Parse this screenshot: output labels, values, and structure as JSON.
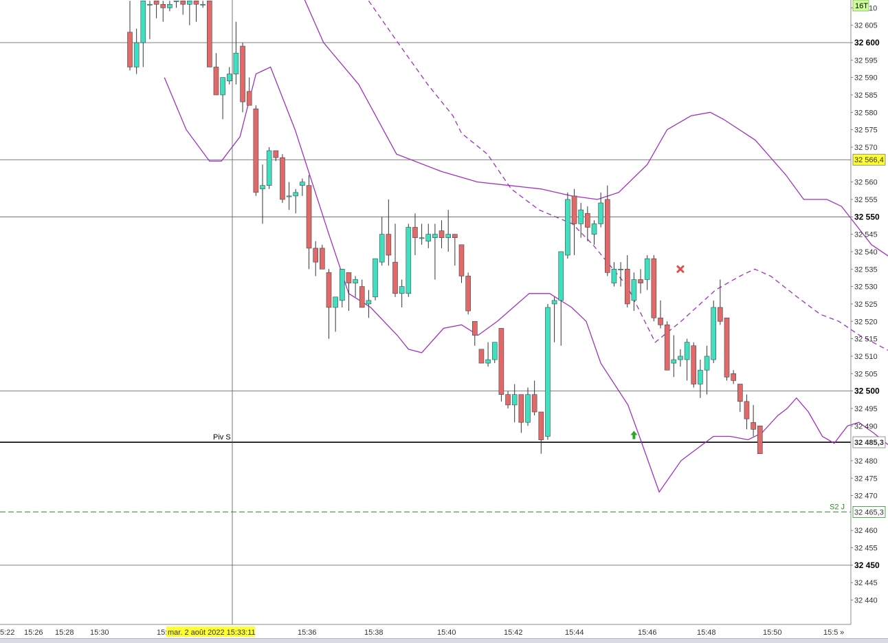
{
  "toolbar": {
    "timeframe_badge": "16T",
    "crosshair_time_label": "mar. 2 août 2022 15:33:11",
    "scroll_right_glyph": "»"
  },
  "colors": {
    "bull": "#3fe0c0",
    "bear": "#e06a6a",
    "wick": "#333333",
    "band": "#a030c0",
    "pivot_line": "#000000",
    "s2_line": "#2a8a2a",
    "grid": "#555555",
    "badge_yellow": "#ffff33",
    "badge_green": "#ccff99",
    "signal_buy": "#22aa22",
    "signal_sell": "#e05050"
  },
  "chart_data": {
    "type": "candlestick",
    "title": "",
    "xlabel": "",
    "ylabel": "",
    "ylim": [
      32433,
      32612
    ],
    "x_ticks": [
      "5:22",
      "15:26",
      "15:28",
      "15:30",
      "15:",
      "15:36",
      "15:38",
      "15:40",
      "15:42",
      "15:44",
      "15:46",
      "15:48",
      "15:50",
      "15:5"
    ],
    "y_ticks": [
      {
        "label": "10",
        "value": 32610,
        "bold": false
      },
      {
        "label": "32 605",
        "value": 32605,
        "bold": false
      },
      {
        "label": "32 600",
        "value": 32600,
        "bold": true
      },
      {
        "label": "32 595",
        "value": 32595,
        "bold": false
      },
      {
        "label": "32 590",
        "value": 32590,
        "bold": false
      },
      {
        "label": "32 585",
        "value": 32585,
        "bold": false
      },
      {
        "label": "32 580",
        "value": 32580,
        "bold": false
      },
      {
        "label": "32 575",
        "value": 32575,
        "bold": false
      },
      {
        "label": "32 570",
        "value": 32570,
        "bold": false
      },
      {
        "label": "32 560",
        "value": 32560,
        "bold": false
      },
      {
        "label": "32 555",
        "value": 32555,
        "bold": false
      },
      {
        "label": "32 550",
        "value": 32550,
        "bold": true
      },
      {
        "label": "32 545",
        "value": 32545,
        "bold": false
      },
      {
        "label": "32 540",
        "value": 32540,
        "bold": false
      },
      {
        "label": "32 535",
        "value": 32535,
        "bold": false
      },
      {
        "label": "32 530",
        "value": 32530,
        "bold": false
      },
      {
        "label": "32 525",
        "value": 32525,
        "bold": false
      },
      {
        "label": "32 520",
        "value": 32520,
        "bold": false
      },
      {
        "label": "32 515",
        "value": 32515,
        "bold": false
      },
      {
        "label": "32 510",
        "value": 32510,
        "bold": false
      },
      {
        "label": "32 505",
        "value": 32505,
        "bold": false
      },
      {
        "label": "32 500",
        "value": 32500,
        "bold": true
      },
      {
        "label": "32 495",
        "value": 32495,
        "bold": false
      },
      {
        "label": "32 490",
        "value": 32490,
        "bold": false
      },
      {
        "label": "32 480",
        "value": 32480,
        "bold": false
      },
      {
        "label": "32 475",
        "value": 32475,
        "bold": false
      },
      {
        "label": "32 470",
        "value": 32470,
        "bold": false
      },
      {
        "label": "32 460",
        "value": 32460,
        "bold": false
      },
      {
        "label": "32 455",
        "value": 32455,
        "bold": false
      },
      {
        "label": "32 450",
        "value": 32450,
        "bold": true
      },
      {
        "label": "32 445",
        "value": 32445,
        "bold": false
      },
      {
        "label": "32 440",
        "value": 32440,
        "bold": false
      }
    ],
    "h_lines": [
      {
        "value": 32600,
        "style": "grid"
      },
      {
        "value": 32566.4,
        "style": "grid",
        "badge": "32 566,4",
        "badge_color": "yellow"
      },
      {
        "value": 32550,
        "style": "grid"
      },
      {
        "value": 32500,
        "style": "grid"
      },
      {
        "value": 32485.3,
        "style": "pivot",
        "label": "Piv S",
        "badge": "32 485,3",
        "badge_color": "white"
      },
      {
        "value": 32465.3,
        "style": "s2",
        "label": "S2 J",
        "badge": "32 465,3",
        "badge_color": "white"
      },
      {
        "value": 32450,
        "style": "grid"
      }
    ],
    "candles": [
      {
        "o": 32603,
        "h": 32612,
        "l": 32592,
        "c": 32593
      },
      {
        "o": 32593,
        "h": 32604,
        "l": 32591,
        "c": 32600
      },
      {
        "o": 32600,
        "h": 32612,
        "l": 32593,
        "c": 32612
      },
      {
        "o": 32611,
        "h": 32612,
        "l": 32601,
        "c": 32611
      },
      {
        "o": 32612,
        "h": 32612,
        "l": 32607,
        "c": 32611
      },
      {
        "o": 32611,
        "h": 32612,
        "l": 32606,
        "c": 32610
      },
      {
        "o": 32610,
        "h": 32612,
        "l": 32609,
        "c": 32611
      },
      {
        "o": 32612,
        "h": 32612,
        "l": 32610,
        "c": 32612
      },
      {
        "o": 32612,
        "h": 32612,
        "l": 32608,
        "c": 32611
      },
      {
        "o": 32611,
        "h": 32612,
        "l": 32605,
        "c": 32612
      },
      {
        "o": 32612,
        "h": 32612,
        "l": 32606,
        "c": 32611
      },
      {
        "o": 32611,
        "h": 32612,
        "l": 32610,
        "c": 32611
      },
      {
        "o": 32612,
        "h": 32612,
        "l": 32593,
        "c": 32593
      },
      {
        "o": 32593,
        "h": 32597,
        "l": 32585,
        "c": 32585
      },
      {
        "o": 32585,
        "h": 32590,
        "l": 32578,
        "c": 32590
      },
      {
        "o": 32589,
        "h": 32593,
        "l": 32588,
        "c": 32591
      },
      {
        "o": 32591,
        "h": 32606,
        "l": 32588,
        "c": 32597
      },
      {
        "o": 32599,
        "h": 32600,
        "l": 32580,
        "c": 32583
      },
      {
        "o": 32586,
        "h": 32590,
        "l": 32582,
        "c": 32582
      },
      {
        "o": 32581,
        "h": 32582,
        "l": 32556,
        "c": 32557
      },
      {
        "o": 32558,
        "h": 32565,
        "l": 32548,
        "c": 32559
      },
      {
        "o": 32559,
        "h": 32570,
        "l": 32558,
        "c": 32569
      },
      {
        "o": 32569,
        "h": 32569,
        "l": 32566,
        "c": 32567
      },
      {
        "o": 32567,
        "h": 32568,
        "l": 32554,
        "c": 32555
      },
      {
        "o": 32556,
        "h": 32560,
        "l": 32552,
        "c": 32556
      },
      {
        "o": 32556,
        "h": 32558,
        "l": 32551,
        "c": 32557
      },
      {
        "o": 32559,
        "h": 32561,
        "l": 32556,
        "c": 32560
      },
      {
        "o": 32559,
        "h": 32562,
        "l": 32535,
        "c": 32541
      },
      {
        "o": 32541,
        "h": 32543,
        "l": 32533,
        "c": 32537
      },
      {
        "o": 32541,
        "h": 32542,
        "l": 32535,
        "c": 32535
      },
      {
        "o": 32534,
        "h": 32535,
        "l": 32515,
        "c": 32524
      },
      {
        "o": 32524,
        "h": 32527,
        "l": 32517,
        "c": 32527
      },
      {
        "o": 32526,
        "h": 32535,
        "l": 32524,
        "c": 32535
      },
      {
        "o": 32534,
        "h": 32534,
        "l": 32523,
        "c": 32531
      },
      {
        "o": 32531,
        "h": 32533,
        "l": 32527,
        "c": 32532
      },
      {
        "o": 32530,
        "h": 32532,
        "l": 32524,
        "c": 32524
      },
      {
        "o": 32525,
        "h": 32529,
        "l": 32521,
        "c": 32526
      },
      {
        "o": 32527,
        "h": 32538,
        "l": 32526,
        "c": 32538
      },
      {
        "o": 32537,
        "h": 32550,
        "l": 32536,
        "c": 32545
      },
      {
        "o": 32545,
        "h": 32555,
        "l": 32536,
        "c": 32539
      },
      {
        "o": 32537,
        "h": 32548,
        "l": 32527,
        "c": 32528
      },
      {
        "o": 32528,
        "h": 32532,
        "l": 32524,
        "c": 32530
      },
      {
        "o": 32528,
        "h": 32548,
        "l": 32527,
        "c": 32547
      },
      {
        "o": 32547,
        "h": 32551,
        "l": 32539,
        "c": 32544
      },
      {
        "o": 32544,
        "h": 32548,
        "l": 32542,
        "c": 32544
      },
      {
        "o": 32543,
        "h": 32548,
        "l": 32541,
        "c": 32545
      },
      {
        "o": 32544,
        "h": 32548,
        "l": 32532,
        "c": 32545
      },
      {
        "o": 32546,
        "h": 32549,
        "l": 32541,
        "c": 32544
      },
      {
        "o": 32544,
        "h": 32552,
        "l": 32540,
        "c": 32545
      },
      {
        "o": 32545,
        "h": 32545,
        "l": 32536,
        "c": 32544
      },
      {
        "o": 32542,
        "h": 32542,
        "l": 32531,
        "c": 32533
      },
      {
        "o": 32533,
        "h": 32534,
        "l": 32522,
        "c": 32523
      },
      {
        "o": 32520,
        "h": 32520,
        "l": 32513,
        "c": 32516
      },
      {
        "o": 32512,
        "h": 32512,
        "l": 32508,
        "c": 32508
      },
      {
        "o": 32508,
        "h": 32514,
        "l": 32507,
        "c": 32509
      },
      {
        "o": 32509,
        "h": 32514,
        "l": 32508,
        "c": 32514
      },
      {
        "o": 32518,
        "h": 32518,
        "l": 32497,
        "c": 32499
      },
      {
        "o": 32499,
        "h": 32500,
        "l": 32495,
        "c": 32496
      },
      {
        "o": 32496,
        "h": 32502,
        "l": 32491,
        "c": 32499
      },
      {
        "o": 32499,
        "h": 32499,
        "l": 32488,
        "c": 32491
      },
      {
        "o": 32491,
        "h": 32501,
        "l": 32490,
        "c": 32499
      },
      {
        "o": 32499,
        "h": 32503,
        "l": 32493,
        "c": 32494
      },
      {
        "o": 32494,
        "h": 32494,
        "l": 32482,
        "c": 32486
      },
      {
        "o": 32487,
        "h": 32525,
        "l": 32486,
        "c": 32524
      },
      {
        "o": 32525,
        "h": 32527,
        "l": 32514,
        "c": 32526
      },
      {
        "o": 32526,
        "h": 32540,
        "l": 32513,
        "c": 32540
      },
      {
        "o": 32539,
        "h": 32557,
        "l": 32538,
        "c": 32555
      },
      {
        "o": 32556,
        "h": 32558,
        "l": 32539,
        "c": 32548
      },
      {
        "o": 32548,
        "h": 32554,
        "l": 32544,
        "c": 32552
      },
      {
        "o": 32551,
        "h": 32553,
        "l": 32543,
        "c": 32547
      },
      {
        "o": 32545,
        "h": 32549,
        "l": 32542,
        "c": 32548
      },
      {
        "o": 32548,
        "h": 32557,
        "l": 32547,
        "c": 32554
      },
      {
        "o": 32555,
        "h": 32559,
        "l": 32533,
        "c": 32534
      },
      {
        "o": 32531,
        "h": 32537,
        "l": 32530,
        "c": 32535
      },
      {
        "o": 32535,
        "h": 32537,
        "l": 32530,
        "c": 32535
      },
      {
        "o": 32535,
        "h": 32539,
        "l": 32524,
        "c": 32525
      },
      {
        "o": 32526,
        "h": 32534,
        "l": 32523,
        "c": 32532
      },
      {
        "o": 32532,
        "h": 32535,
        "l": 32528,
        "c": 32531
      },
      {
        "o": 32532,
        "h": 32539,
        "l": 32529,
        "c": 32538
      },
      {
        "o": 32538,
        "h": 32539,
        "l": 32520,
        "c": 32521
      },
      {
        "o": 32521,
        "h": 32526,
        "l": 32518,
        "c": 32519
      },
      {
        "o": 32519,
        "h": 32520,
        "l": 32506,
        "c": 32506
      },
      {
        "o": 32508,
        "h": 32516,
        "l": 32504,
        "c": 32509
      },
      {
        "o": 32509,
        "h": 32512,
        "l": 32507,
        "c": 32510
      },
      {
        "o": 32509,
        "h": 32515,
        "l": 32503,
        "c": 32514
      },
      {
        "o": 32513,
        "h": 32514,
        "l": 32501,
        "c": 32502
      },
      {
        "o": 32502,
        "h": 32509,
        "l": 32498,
        "c": 32506
      },
      {
        "o": 32506,
        "h": 32513,
        "l": 32499,
        "c": 32510
      },
      {
        "o": 32509,
        "h": 32526,
        "l": 32508,
        "c": 32524
      },
      {
        "o": 32524,
        "h": 32532,
        "l": 32519,
        "c": 32520
      },
      {
        "o": 32521,
        "h": 32521,
        "l": 32503,
        "c": 32504
      },
      {
        "o": 32505,
        "h": 32506,
        "l": 32502,
        "c": 32503
      },
      {
        "o": 32502,
        "h": 32502,
        "l": 32494,
        "c": 32497
      },
      {
        "o": 32497,
        "h": 32499,
        "l": 32489,
        "c": 32492
      },
      {
        "o": 32491,
        "h": 32496,
        "l": 32487,
        "c": 32489
      },
      {
        "o": 32490,
        "h": 32490,
        "l": 32482,
        "c": 32482
      }
    ],
    "bands": {
      "upper": [
        [
          0,
          32700
        ],
        [
          13.7,
          32660
        ],
        [
          19.4,
          32640
        ],
        [
          23.4,
          32625
        ],
        [
          29.2,
          32600
        ],
        [
          34.5,
          32588
        ],
        [
          40.2,
          32568
        ],
        [
          47.0,
          32563
        ],
        [
          52.4,
          32560
        ],
        [
          57.2,
          32559
        ],
        [
          62.0,
          32558
        ],
        [
          66.6,
          32556
        ],
        [
          70.5,
          32555
        ],
        [
          73.7,
          32557
        ],
        [
          78.0,
          32565
        ],
        [
          81.0,
          32575
        ],
        [
          84.6,
          32579
        ],
        [
          87.5,
          32580
        ],
        [
          89.5,
          32578
        ],
        [
          94.3,
          32572
        ],
        [
          98.9,
          32562
        ],
        [
          101.6,
          32555
        ],
        [
          105.1,
          32555
        ],
        [
          107.3,
          32553
        ],
        [
          111.8,
          32542
        ],
        [
          115.7,
          32537
        ],
        [
          118,
          32535
        ]
      ],
      "lower": [
        [
          5.2,
          32590
        ],
        [
          8.5,
          32575
        ],
        [
          12.0,
          32566
        ],
        [
          13.8,
          32566
        ],
        [
          16.6,
          32573
        ],
        [
          19.0,
          32591
        ],
        [
          21.2,
          32593
        ],
        [
          24.9,
          32575
        ],
        [
          30.0,
          32545
        ],
        [
          33.0,
          32528
        ],
        [
          36.3,
          32524
        ],
        [
          40.3,
          32516
        ],
        [
          42.0,
          32512
        ],
        [
          44.0,
          32511
        ],
        [
          47.3,
          32518
        ],
        [
          50.0,
          32519
        ],
        [
          52.5,
          32516
        ],
        [
          55.4,
          32520
        ],
        [
          58.4,
          32525
        ],
        [
          60.2,
          32528
        ],
        [
          63.3,
          32528
        ],
        [
          66.6,
          32524
        ],
        [
          68.8,
          32520
        ],
        [
          71.0,
          32508
        ],
        [
          75.1,
          32496
        ],
        [
          77.0,
          32486
        ],
        [
          79.8,
          32471
        ],
        [
          83.1,
          32480
        ],
        [
          88.0,
          32487
        ],
        [
          90.5,
          32487
        ],
        [
          93.2,
          32486
        ],
        [
          95.3,
          32488
        ],
        [
          97.7,
          32493
        ],
        [
          99.1,
          32495
        ],
        [
          100.5,
          32498
        ],
        [
          102.3,
          32494
        ],
        [
          104.4,
          32487
        ],
        [
          106.2,
          32485
        ],
        [
          108.2,
          32490
        ],
        [
          109.9,
          32491
        ],
        [
          112.1,
          32488
        ],
        [
          116.0,
          32482
        ],
        [
          118,
          32477
        ]
      ],
      "middle": [
        [
          36.0,
          32612
        ],
        [
          40.4,
          32600
        ],
        [
          44.9,
          32588
        ],
        [
          48.7,
          32579
        ],
        [
          50.0,
          32574
        ],
        [
          53.9,
          32568
        ],
        [
          57.5,
          32558
        ],
        [
          61.7,
          32552
        ],
        [
          66.7,
          32548
        ],
        [
          69.8,
          32542
        ],
        [
          75.0,
          32530
        ],
        [
          79.2,
          32514
        ],
        [
          83.1,
          32520
        ],
        [
          88.3,
          32529
        ],
        [
          92.0,
          32533
        ],
        [
          94.2,
          32535
        ],
        [
          96.6,
          32533
        ],
        [
          100.6,
          32527
        ],
        [
          104.1,
          32522
        ],
        [
          106.9,
          32520
        ],
        [
          110.0,
          32516
        ],
        [
          115.0,
          32511
        ],
        [
          118,
          32504
        ]
      ]
    },
    "signals": [
      {
        "type": "buy-arrow",
        "index": 76,
        "value": 32487
      },
      {
        "type": "sell-cross",
        "index": 83,
        "value": 32535
      }
    ]
  }
}
